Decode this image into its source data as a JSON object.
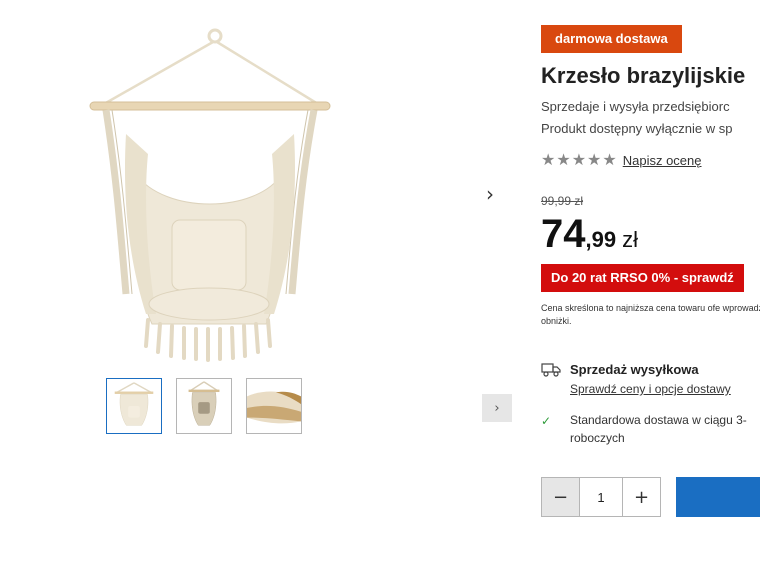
{
  "gallery": {
    "next_icon": "chevron-right",
    "thumbs_next_icon": "chevron-right",
    "thumbnails": [
      "hammock-chair-front",
      "hammock-chair-angle",
      "cushion-detail"
    ],
    "active_thumbnail": 0
  },
  "product": {
    "badge": "darmowa dostawa",
    "title": "Krzesło brazylijskie",
    "seller_line_1": "Sprzedaje i wysyła przedsiębiorc",
    "seller_line_2": "Produkt dostępny wyłącznie w sp",
    "rating_stars": 5,
    "review_link": "Napisz ocenę",
    "old_price": "99,99 zł",
    "price_integer": "74",
    "price_decimal": ",99",
    "price_currency": "zł",
    "installment": "Do 20 rat RRSO 0% - sprawdź",
    "price_note": "Cena skreślona to najniższa cena towaru ofe wprowadzeniem obniżki."
  },
  "shipping": {
    "icon": "truck-icon",
    "title": "Sprzedaż wysyłkowa",
    "link": "Sprawdź ceny i opcje dostawy",
    "delivery_icon": "check-icon",
    "delivery_text": "Standardowa dostawa w ciągu 3- roboczych"
  },
  "purchase": {
    "minus": "−",
    "quantity": "1",
    "plus": "+"
  },
  "colors": {
    "badge": "#d9480f",
    "installment": "#d30d0d",
    "cart_button": "#1a6ec2",
    "check": "#2e9b3a"
  }
}
